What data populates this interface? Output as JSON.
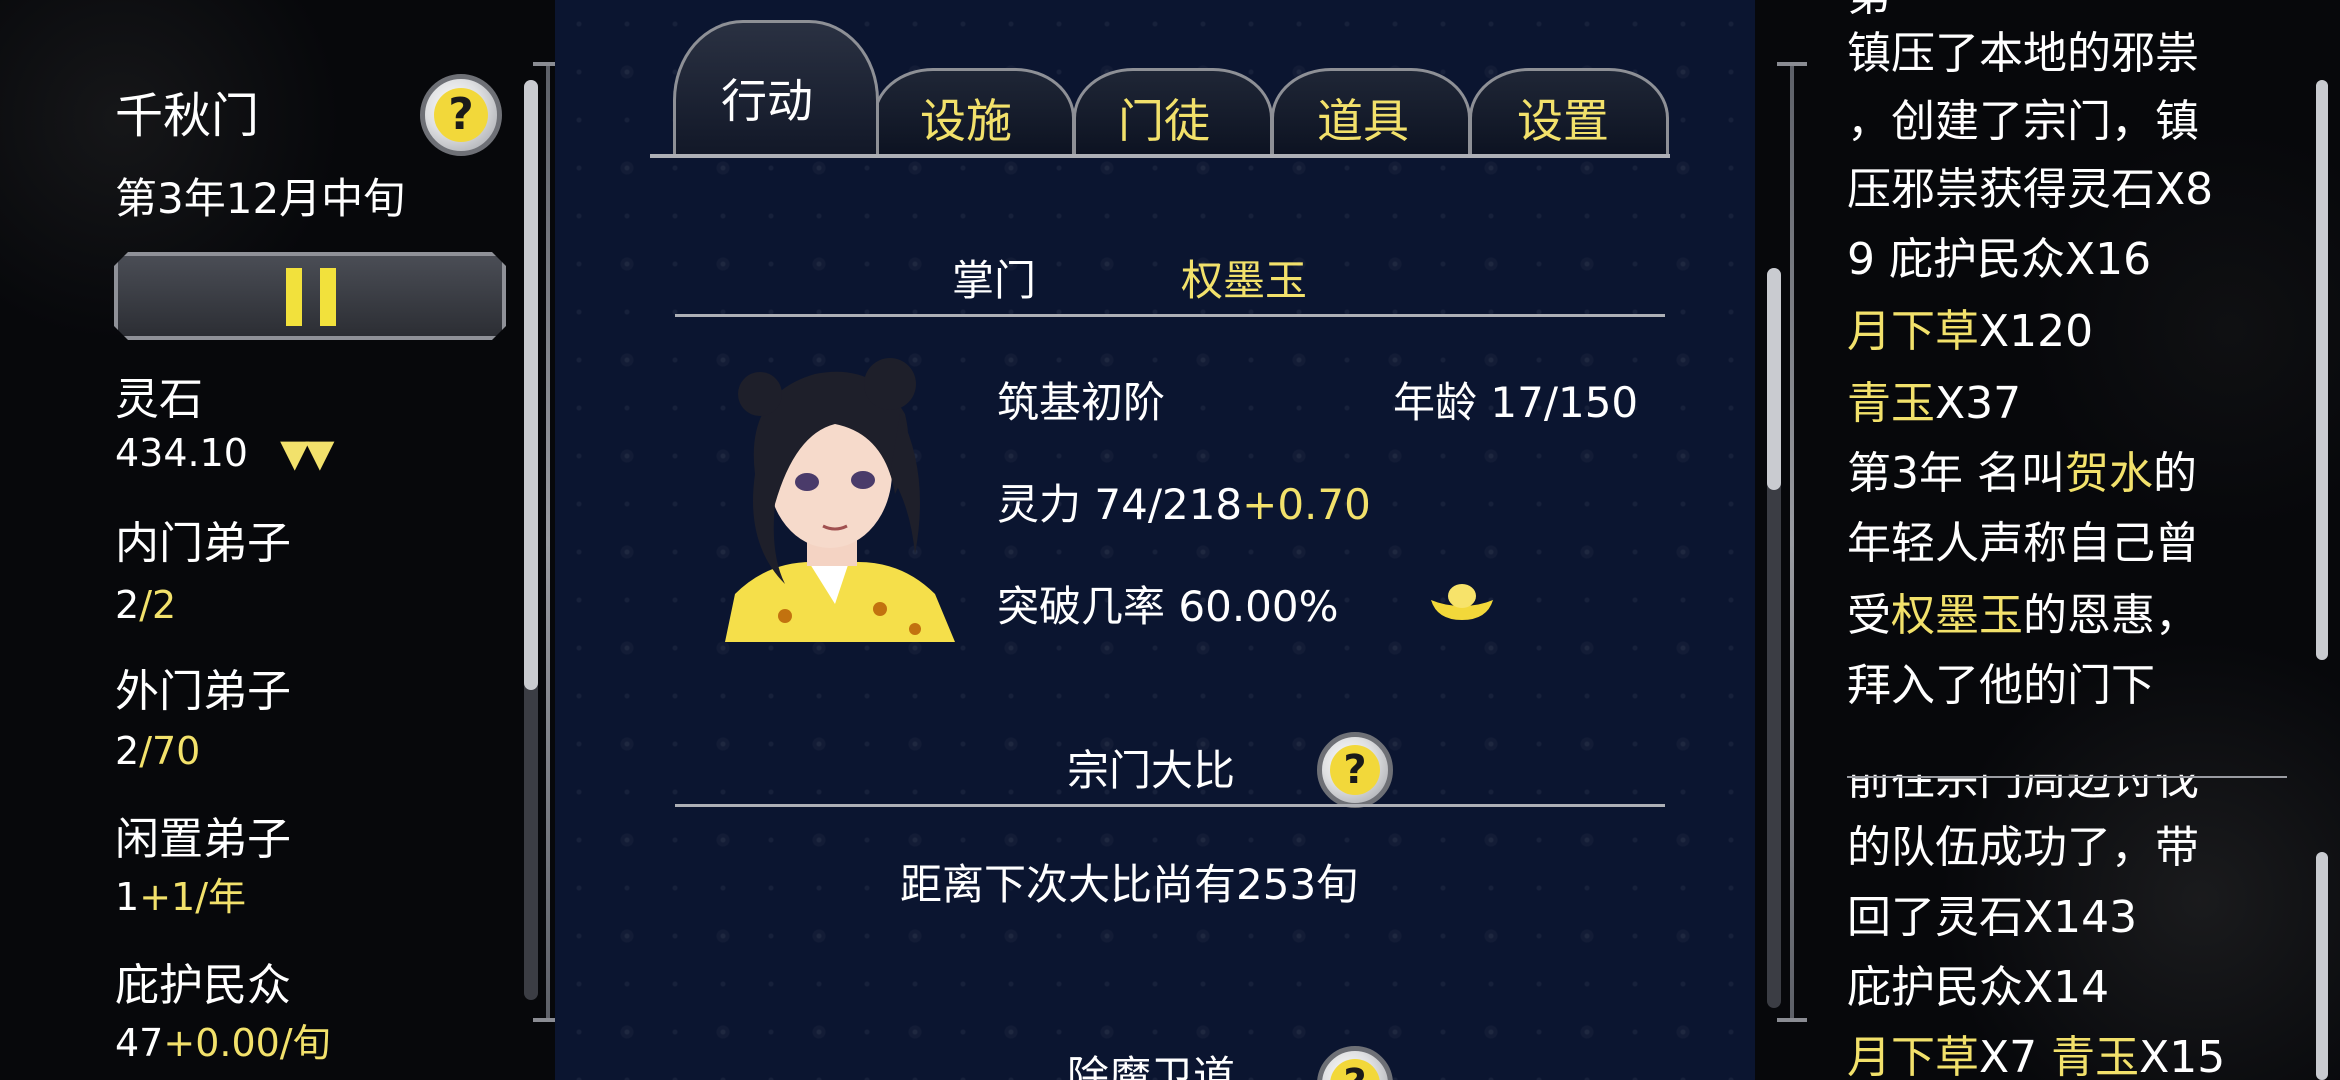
{
  "sect": {
    "name": "千秋门",
    "date": "第3年12月中旬"
  },
  "resources": {
    "spirit_stone": {
      "label": "灵石",
      "value": "434.10",
      "trend": "▼▼"
    },
    "inner_disciples": {
      "label": "内门弟子",
      "current": "2",
      "max": "/2"
    },
    "outer_disciples": {
      "label": "外门弟子",
      "current": "2",
      "max": "/70"
    },
    "idle_disciples": {
      "label": "闲置弟子",
      "current": "1",
      "rate": "+1/年"
    },
    "protected_people": {
      "label": "庇护民众",
      "current": "47",
      "rate": "+0.00/旬"
    }
  },
  "tabs": [
    {
      "label": "行动",
      "active": true
    },
    {
      "label": "设施",
      "active": false
    },
    {
      "label": "门徒",
      "active": false
    },
    {
      "label": "道具",
      "active": false
    },
    {
      "label": "设置",
      "active": false
    }
  ],
  "leader": {
    "title": "掌门",
    "name": "权墨玉",
    "realm": "筑基初阶",
    "age_label": "年龄",
    "age": "17/150",
    "spirit_label": "灵力",
    "spirit": "74/218",
    "spirit_rate": "+0.70",
    "breakthrough_label": "突破几率",
    "breakthrough": "60.00%"
  },
  "competition": {
    "title": "宗门大比",
    "countdown": "距离下次大比尚有253旬"
  },
  "next_section": {
    "title_partial": "除魔卫道"
  },
  "log": {
    "lines": [
      {
        "segments": [
          {
            "text": "镇压了本地的邪祟"
          }
        ]
      },
      {
        "segments": [
          {
            "text": "，创建了宗门，镇"
          }
        ]
      },
      {
        "segments": [
          {
            "text": "压邪祟获得灵石X8"
          }
        ]
      },
      {
        "segments": [
          {
            "text": "9 庇护民众X16"
          }
        ]
      },
      {
        "segments": [
          {
            "text": "月下草",
            "highlight": true
          },
          {
            "text": "X120"
          }
        ]
      },
      {
        "segments": [
          {
            "text": "青玉",
            "highlight": true
          },
          {
            "text": "X37"
          }
        ]
      },
      {
        "segments": [
          {
            "text": "第3年 名叫"
          },
          {
            "text": "贺水",
            "highlight": true
          },
          {
            "text": "的"
          }
        ]
      },
      {
        "segments": [
          {
            "text": "年轻人声称自己曾"
          }
        ]
      },
      {
        "segments": [
          {
            "text": "受"
          },
          {
            "text": "权墨玉",
            "highlight": true
          },
          {
            "text": "的恩惠，"
          }
        ]
      },
      {
        "segments": [
          {
            "text": "拜入了他的门下"
          }
        ]
      },
      {
        "segments": [
          {
            "text": "前往宗门周边讨伐"
          }
        ]
      },
      {
        "segments": [
          {
            "text": "的队伍成功了，带"
          }
        ]
      },
      {
        "segments": [
          {
            "text": "回了灵石X143"
          }
        ]
      },
      {
        "segments": [
          {
            "text": "庇护民众X14"
          }
        ]
      },
      {
        "segments": [
          {
            "text": "月下草",
            "highlight": true
          },
          {
            "text": "X7 "
          },
          {
            "text": "青玉",
            "highlight": true
          },
          {
            "text": "X15"
          }
        ]
      }
    ]
  },
  "colors": {
    "highlight": "#f2e16b",
    "text": "#ffffff",
    "panel": "#0b1530"
  },
  "icons": {
    "help": "question-mark-icon",
    "pause": "pause-icon",
    "gold_ingot": "gold-ingot-icon"
  }
}
